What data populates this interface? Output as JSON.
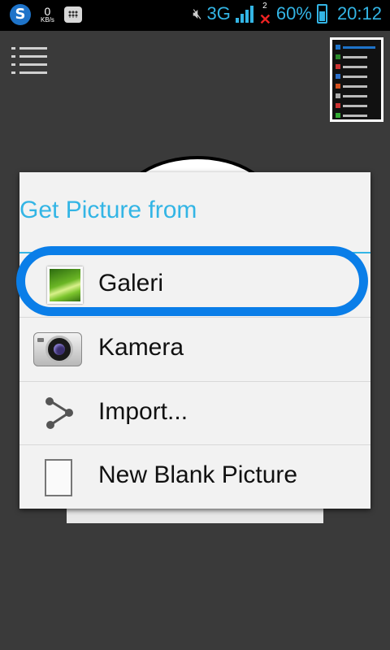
{
  "status_bar": {
    "kbs_value": "0",
    "kbs_unit": "KB/s",
    "network": "3G",
    "sim_badge": "2",
    "battery_percent": "60%",
    "time": "20:12",
    "accent_color": "#33b5e5",
    "icons": [
      "s-app-icon",
      "bbm-icon",
      "mute-icon",
      "signal-icon",
      "no-sim-icon",
      "battery-icon"
    ]
  },
  "app": {
    "menu_icon": "list-menu-icon"
  },
  "dialog": {
    "title": "Get Picture from",
    "title_color": "#33b5e5",
    "options": [
      {
        "label": "Galeri",
        "icon": "gallery-icon"
      },
      {
        "label": "Kamera",
        "icon": "camera-icon"
      },
      {
        "label": "Import...",
        "icon": "share-icon"
      },
      {
        "label": "New Blank Picture",
        "icon": "blank-page-icon"
      }
    ],
    "highlight_color": "#0a7ee8"
  }
}
